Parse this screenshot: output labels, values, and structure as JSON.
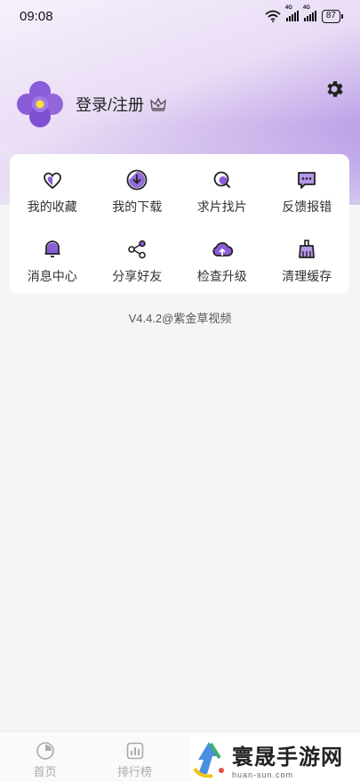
{
  "status_bar": {
    "time": "09:08",
    "signal1": "4G",
    "signal2": "4G",
    "battery": "87"
  },
  "profile": {
    "login_label": "登录/注册"
  },
  "colors": {
    "accent": "#8a5cd8",
    "accent_light": "#b89ae6",
    "card_bg": "#ffffff",
    "page_bg": "#f5f5f7"
  },
  "menu": [
    {
      "label": "我的收藏",
      "icon": "heart-icon"
    },
    {
      "label": "我的下载",
      "icon": "download-icon"
    },
    {
      "label": "求片找片",
      "icon": "search-film-icon"
    },
    {
      "label": "反馈报错",
      "icon": "feedback-icon"
    },
    {
      "label": "消息中心",
      "icon": "bell-icon"
    },
    {
      "label": "分享好友",
      "icon": "share-icon"
    },
    {
      "label": "检查升级",
      "icon": "cloud-upgrade-icon"
    },
    {
      "label": "清理缓存",
      "icon": "broom-icon"
    }
  ],
  "version": "V4.4.2@紫金草视频",
  "tabbar": [
    {
      "label": "首页",
      "icon": "home-icon"
    },
    {
      "label": "排行榜",
      "icon": "ranking-icon"
    }
  ],
  "watermark": {
    "title": "寰晟手游网",
    "url": "huan-sun.com"
  }
}
